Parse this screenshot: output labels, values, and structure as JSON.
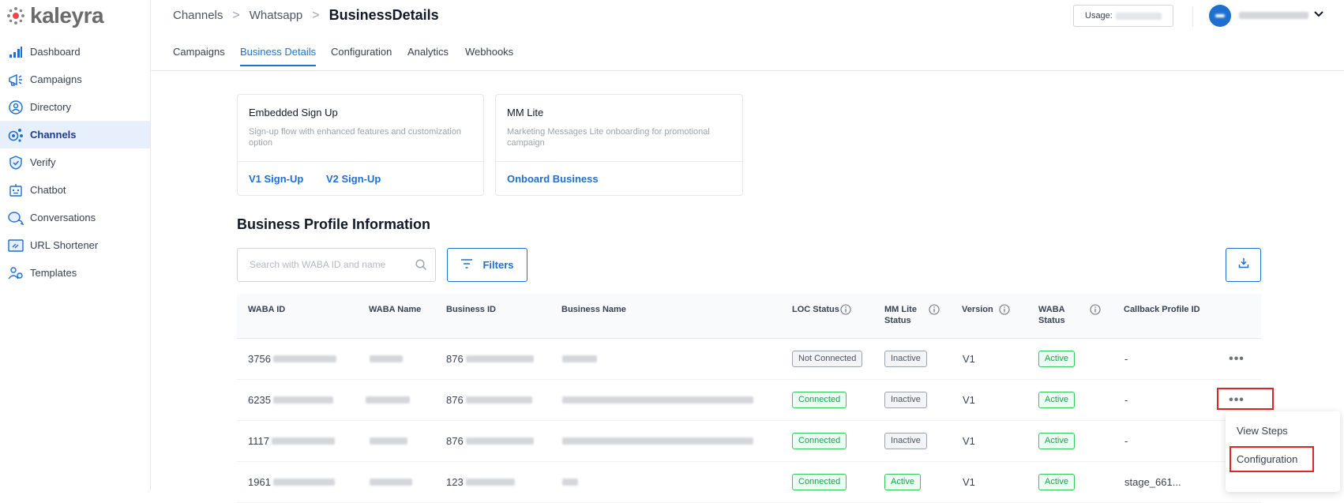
{
  "brand": {
    "name": "kaleyra",
    "color": "#e54b4b"
  },
  "sidebar": {
    "items": [
      {
        "label": "Dashboard",
        "icon": "bar-chart-icon"
      },
      {
        "label": "Campaigns",
        "icon": "megaphone-icon"
      },
      {
        "label": "Directory",
        "icon": "contact-icon"
      },
      {
        "label": "Channels",
        "icon": "channels-icon",
        "active": true
      },
      {
        "label": "Verify",
        "icon": "shield-icon"
      },
      {
        "label": "Chatbot",
        "icon": "chatbot-icon"
      },
      {
        "label": "Conversations",
        "icon": "chat-bubbles-icon"
      },
      {
        "label": "URL Shortener",
        "icon": "link-icon"
      },
      {
        "label": "Templates",
        "icon": "templates-icon"
      }
    ]
  },
  "breadcrumb": {
    "item1": "Channels",
    "item2": "Whatsapp",
    "current": "BusinessDetails"
  },
  "header": {
    "usage_label": "Usage:"
  },
  "tabs": [
    {
      "label": "Campaigns"
    },
    {
      "label": "Business Details",
      "active": true
    },
    {
      "label": "Configuration"
    },
    {
      "label": "Analytics"
    },
    {
      "label": "Webhooks"
    }
  ],
  "cards": {
    "embedded": {
      "title": "Embedded Sign Up",
      "description": "Sign-up flow with enhanced features and customization option",
      "link1": "V1 Sign-Up",
      "link2": "V2 Sign-Up"
    },
    "mmlite": {
      "title": "MM Lite",
      "description": "Marketing Messages Lite onboarding for promotional campaign",
      "link1": "Onboard Business"
    }
  },
  "section_title": "Business Profile Information",
  "search": {
    "placeholder": "Search with WABA ID and name"
  },
  "filters_label": "Filters",
  "table": {
    "headers": {
      "waba_id": "WABA ID",
      "waba_name": "WABA Name",
      "business_id": "Business ID",
      "business_name": "Business Name",
      "loc_status": "LOC Status",
      "mm_lite_1": "MM Lite",
      "mm_lite_2": "Status",
      "version": "Version",
      "waba_status_1": "WABA",
      "waba_status_2": "Status",
      "callback": "Callback Profile ID"
    },
    "rows": [
      {
        "waba_id": "3756",
        "business_id": "876",
        "loc": "Not Connected",
        "mm": "Inactive",
        "version": "V1",
        "waba_status": "Active",
        "callback": "-"
      },
      {
        "waba_id": "6235",
        "business_id": "876",
        "loc": "Connected",
        "mm": "Inactive",
        "version": "V1",
        "waba_status": "Active",
        "callback": "-"
      },
      {
        "waba_id": "1117",
        "business_id": "876",
        "loc": "Connected",
        "mm": "Inactive",
        "version": "V1",
        "waba_status": "Active",
        "callback": "-"
      },
      {
        "waba_id": "1961",
        "business_id": "123",
        "loc": "Connected",
        "mm": "Active",
        "version": "V1",
        "waba_status": "Active",
        "callback": "stage_661..."
      }
    ]
  },
  "row_actions_label": "•••",
  "context_menu": {
    "view_steps": "View Steps",
    "configuration": "Configuration"
  },
  "colors": {
    "primary": "#1f6fd1",
    "success": "#16a34a",
    "highlight": "#dc2626"
  }
}
